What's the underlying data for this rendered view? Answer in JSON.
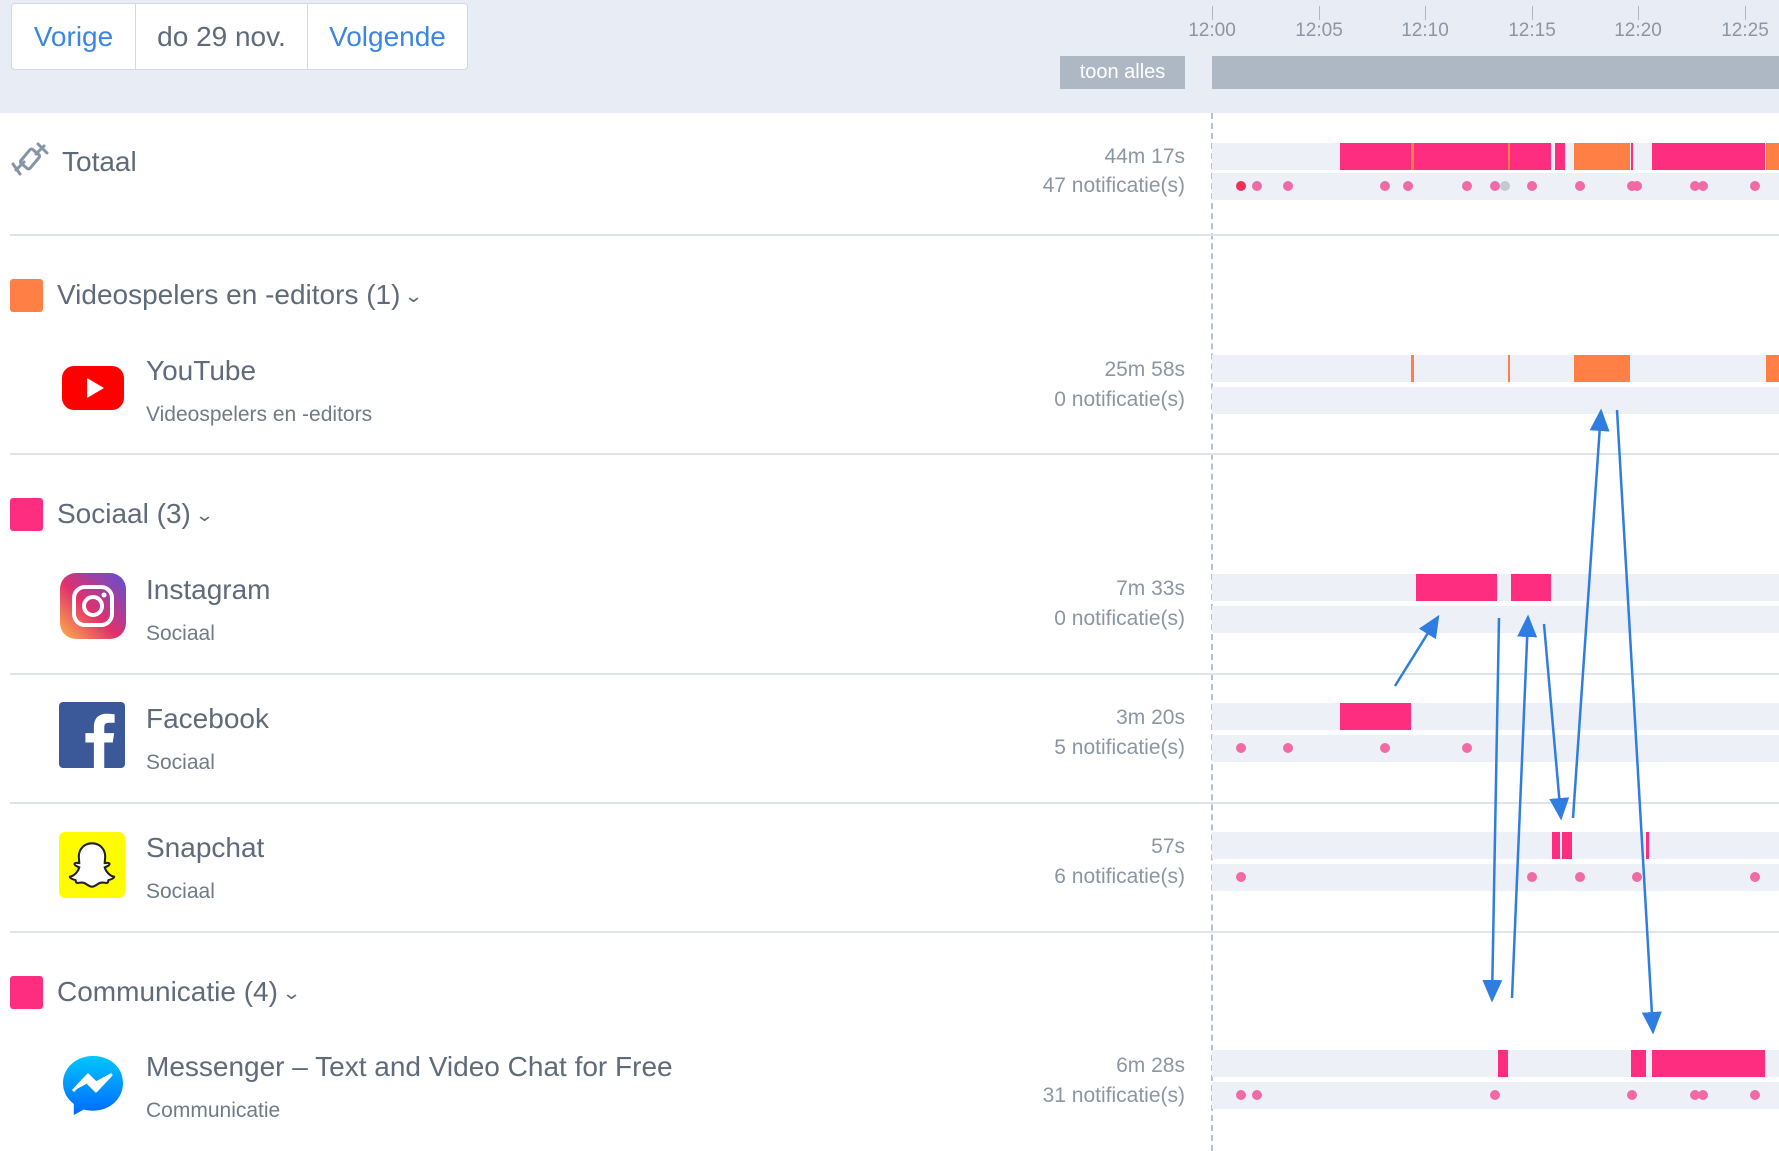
{
  "nav": {
    "prev_label": "Vorige",
    "date_label": "do 29 nov.",
    "next_label": "Volgende"
  },
  "show_all_label": "toon alles",
  "timeline": {
    "ticks": [
      "12:00",
      "12:05",
      "12:10",
      "12:15",
      "12:20",
      "12:25"
    ],
    "colors": {
      "social": "#ff2d7f",
      "video": "#ff7f45",
      "notification": "#f06aa6",
      "notification_strong": "#ef2f5a",
      "notification_muted": "#c4c9d0"
    }
  },
  "total": {
    "name": "Totaal",
    "duration": "44m 17s",
    "notifications": "47 notificatie(s)",
    "icon": "satellite-icon"
  },
  "categories": {
    "video": {
      "label": "Videospelers en -editors (1)",
      "color": "#ff7f45"
    },
    "social": {
      "label": "Sociaal (3)",
      "color": "#ff2d7f"
    },
    "communication": {
      "label": "Communicatie (4)",
      "color": "#ff2d7f"
    }
  },
  "apps": {
    "youtube": {
      "name": "YouTube",
      "category": "Videospelers en -editors",
      "duration": "25m 58s",
      "notifications": "0 notificatie(s)",
      "icon": "youtube-icon"
    },
    "instagram": {
      "name": "Instagram",
      "category": "Sociaal",
      "duration": "7m 33s",
      "notifications": "0 notificatie(s)",
      "icon": "instagram-icon"
    },
    "facebook": {
      "name": "Facebook",
      "category": "Sociaal",
      "duration": "3m 20s",
      "notifications": "5 notificatie(s)",
      "icon": "facebook-icon"
    },
    "snapchat": {
      "name": "Snapchat",
      "category": "Sociaal",
      "duration": "57s",
      "notifications": "6 notificatie(s)",
      "icon": "snapchat-icon"
    },
    "messenger": {
      "name": "Messenger – Text and Video Chat for Free",
      "category": "Communicatie",
      "duration": "6m 28s",
      "notifications": "31 notificatie(s)",
      "icon": "messenger-icon"
    }
  }
}
